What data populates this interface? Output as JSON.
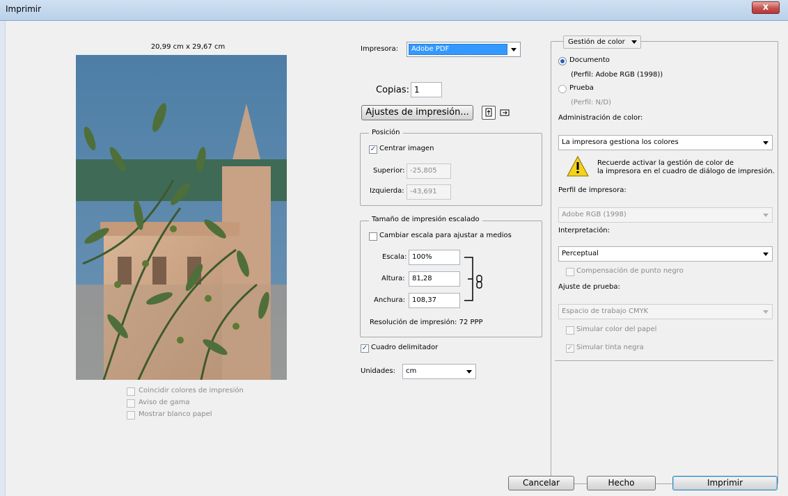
{
  "window": {
    "title": "Imprimir",
    "close_label": "x"
  },
  "preview": {
    "size_label": "20,99 cm x 29,67 cm",
    "options": [
      {
        "label": "Coincidir colores de impresión",
        "checked": false
      },
      {
        "label": "Aviso de gama",
        "checked": false
      },
      {
        "label": "Mostrar blanco papel",
        "checked": false
      }
    ]
  },
  "printer": {
    "label": "Impresora:",
    "value": "Adobe PDF"
  },
  "copies": {
    "label": "Copias:",
    "value": "1"
  },
  "print_settings": {
    "button_label": "Ajustes de impresión..."
  },
  "position": {
    "legend": "Posición",
    "center_label": "Centrar imagen",
    "top_label": "Superior:",
    "top_value": "-25,805",
    "left_label": "Izquierda:",
    "left_value": "-43,691"
  },
  "scaled": {
    "legend": "Tamaño de impresión escalado",
    "fit_label": "Cambiar escala para ajustar a medios",
    "scale_label": "Escala:",
    "scale_value": "100%",
    "height_label": "Altura:",
    "height_value": "81,28",
    "width_label": "Anchura:",
    "width_value": "108,37",
    "resolution": "Resolución de impresión: 72 PPP"
  },
  "bounding_box": {
    "label": "Cuadro delimitador",
    "checked": true
  },
  "units": {
    "label": "Unidades:",
    "value": "cm"
  },
  "color": {
    "section_dropdown": "Gestión de color",
    "document_label": "Documento",
    "document_profile": "(Perfil: Adobe RGB (1998))",
    "proof_label": "Prueba",
    "proof_profile": "(Perfil: N/D)",
    "management_label": "Administración de color:",
    "management_value": "La impresora gestiona los colores",
    "warning_line1": "Recuerde activar la gestión de color de",
    "warning_line2": "la impresora en el cuadro de diálogo de impresión.",
    "printer_profile_label": "Perfil de impresora:",
    "printer_profile_value": "Adobe RGB (1998)",
    "intent_label": "Interpretación:",
    "intent_value": "Perceptual",
    "black_point_label": "Compensación de punto negro",
    "proof_setup_label": "Ajuste de prueba:",
    "proof_setup_value": "Espacio de trabajo CMYK",
    "paper_color_label": "Simular color del papel",
    "black_ink_label": "Simular tinta negra"
  },
  "buttons": {
    "cancel": "Cancelar",
    "done": "Hecho",
    "print": "Imprimir"
  },
  "colors": {
    "accent": "#3399ff",
    "title_bar": "#c6d9ee"
  }
}
